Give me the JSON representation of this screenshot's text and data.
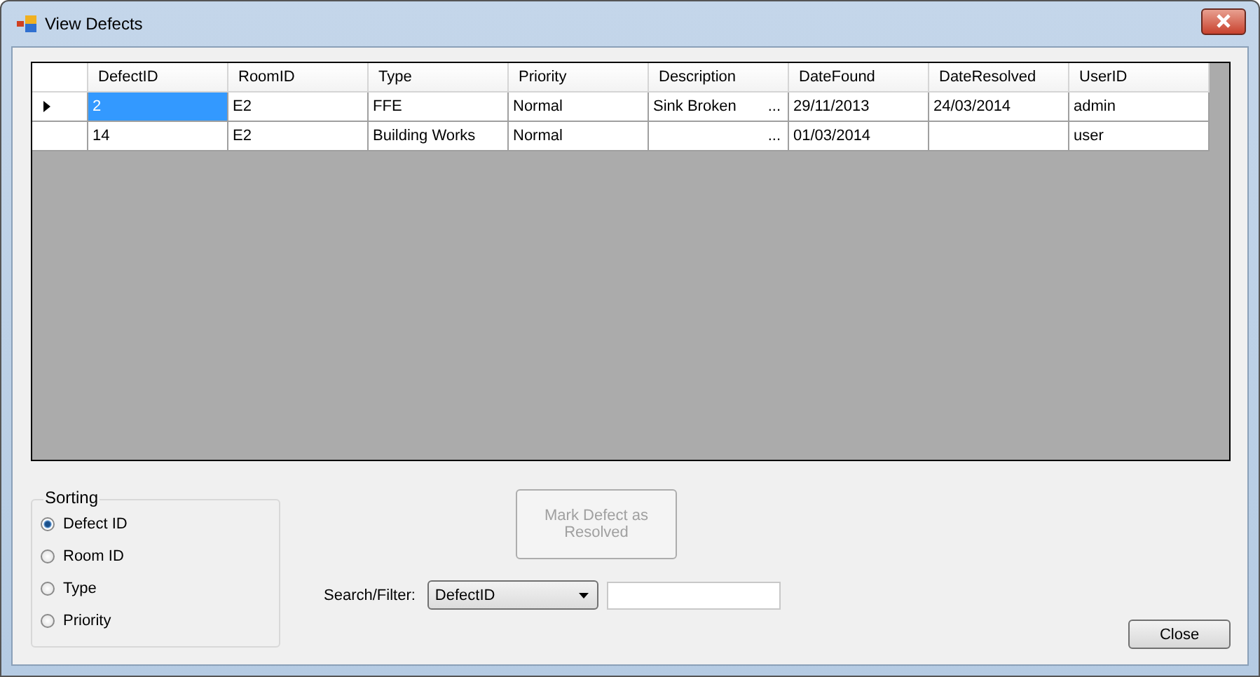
{
  "window": {
    "title": "View Defects"
  },
  "table": {
    "columns": [
      {
        "label": "DefectID"
      },
      {
        "label": "RoomID"
      },
      {
        "label": "Type"
      },
      {
        "label": "Priority"
      },
      {
        "label": "Description"
      },
      {
        "label": "DateFound"
      },
      {
        "label": "DateResolved"
      },
      {
        "label": "UserID"
      }
    ],
    "rows": [
      {
        "current": true,
        "cells": [
          {
            "text": "2",
            "selected": true
          },
          {
            "text": "E2",
            "selected": false
          },
          {
            "text": "FFE",
            "selected": false
          },
          {
            "text": "Normal",
            "selected": false
          },
          {
            "text": "Sink Broken",
            "button": "...",
            "selected": false
          },
          {
            "text": "29/11/2013",
            "selected": false
          },
          {
            "text": "24/03/2014",
            "selected": false
          },
          {
            "text": "admin",
            "selected": false
          }
        ]
      },
      {
        "current": false,
        "cells": [
          {
            "text": "14",
            "selected": false
          },
          {
            "text": "E2",
            "selected": false
          },
          {
            "text": "Building Works",
            "selected": false
          },
          {
            "text": "Normal",
            "selected": false
          },
          {
            "text": "",
            "button": "...",
            "selected": false
          },
          {
            "text": "01/03/2014",
            "selected": false
          },
          {
            "text": "",
            "selected": false
          },
          {
            "text": "user",
            "selected": false
          }
        ]
      }
    ]
  },
  "sorting": {
    "title": "Sorting",
    "options": [
      {
        "label": "Defect ID",
        "selected": true
      },
      {
        "label": "Room ID",
        "selected": false
      },
      {
        "label": "Type",
        "selected": false
      },
      {
        "label": "Priority",
        "selected": false
      }
    ]
  },
  "mark_button": {
    "label": "Mark Defect as Resolved",
    "disabled": true
  },
  "search": {
    "label": "Search/Filter:",
    "field": "DefectID"
  },
  "close_button": {
    "label": "Close"
  }
}
